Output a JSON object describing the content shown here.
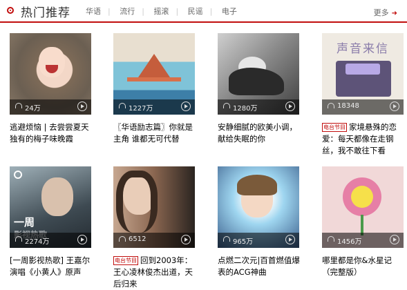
{
  "header": {
    "title": "热门推荐",
    "tags": [
      "华语",
      "流行",
      "摇滚",
      "民谣",
      "电子"
    ],
    "more_label": "更多"
  },
  "playlists": [
    {
      "count": "24万",
      "title": "逃避烦恼 | 去尝尝夏天独有的梅子味晚霞",
      "radio": false
    },
    {
      "count": "1227万",
      "title": "〖华语励志篇〗你就是主角 谁都无可代替",
      "radio": false
    },
    {
      "count": "1280万",
      "title": "安静细腻的欧美小调，献给失眠的你",
      "radio": false
    },
    {
      "count": "18348",
      "title": "家境悬殊的恋爱：每天都像在走钢丝，我不敢往下看",
      "radio": true,
      "cover_text": "声音来信"
    },
    {
      "count": "2274万",
      "title": "[一周影视热歌] 王嘉尔演唱《小黄人》原声",
      "radio": false,
      "cover_text": "一周",
      "cover_text2": "影视热歌"
    },
    {
      "count": "6512",
      "title": "回到2003年：王心凌林俊杰出道，天后归来",
      "radio": true
    },
    {
      "count": "965万",
      "title": "点燃二次元|百首燃值爆表的ACG神曲",
      "radio": false
    },
    {
      "count": "1456万",
      "title": "哪里都是你&水星记（完整版）",
      "radio": false
    }
  ],
  "radio_tag": "电台节目"
}
